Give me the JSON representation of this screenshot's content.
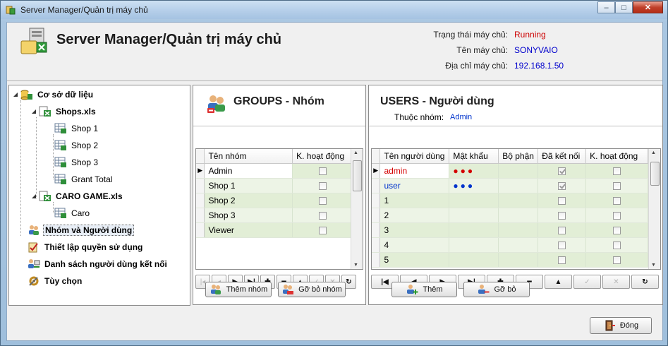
{
  "window": {
    "title": "Server Manager/Quản trị máy chủ",
    "minimize": "–",
    "maximize": "□",
    "close": "✕"
  },
  "header": {
    "title": "Server Manager/Quản trị máy chủ",
    "status_label": "Trạng thái máy chủ:",
    "status_value": "Running",
    "name_label": "Tên máy chủ:",
    "name_value": "SONYVAIO",
    "ip_label": "Địa chỉ máy chủ:",
    "ip_value": "192.168.1.50"
  },
  "tree": {
    "db": "Cơ sở dữ liệu",
    "shops_file": "Shops.xls",
    "sheets": [
      "Shop 1",
      "Shop 2",
      "Shop 3",
      "Grant Total"
    ],
    "caro_file": "CARO GAME.xls",
    "caro_sheet": "Caro",
    "groups_users": "Nhóm và Người dùng",
    "permissions": "Thiết lập quyền sử dụng",
    "connected": "Danh sách người dùng kết nối",
    "options": "Tùy chọn"
  },
  "groups": {
    "title": "GROUPS - Nhóm",
    "columns": [
      "Tên nhóm",
      "K. hoạt động"
    ],
    "rows": [
      {
        "name": "Admin",
        "inactive": false
      },
      {
        "name": "Shop 1",
        "inactive": false
      },
      {
        "name": "Shop 2",
        "inactive": false
      },
      {
        "name": "Shop 3",
        "inactive": false
      },
      {
        "name": "Viewer",
        "inactive": false
      }
    ],
    "add_button": "Thêm nhóm",
    "remove_button": "Gỡ bỏ nhóm"
  },
  "users": {
    "title": "USERS - Người dùng",
    "group_label": "Thuộc nhóm:",
    "group_value": "Admin",
    "columns": [
      "Tên người dùng",
      "Mật khẩu",
      "Bộ phận",
      "Đã kết nối",
      "K. hoạt động"
    ],
    "rows": [
      {
        "name": "admin",
        "password": "●●●",
        "dept": "",
        "connected": true,
        "inactive": false
      },
      {
        "name": "user",
        "password": "●●●",
        "dept": "",
        "connected": true,
        "inactive": false
      },
      {
        "name": "1",
        "password": "",
        "dept": "",
        "connected": false,
        "inactive": false
      },
      {
        "name": "2",
        "password": "",
        "dept": "",
        "connected": false,
        "inactive": false
      },
      {
        "name": "3",
        "password": "",
        "dept": "",
        "connected": false,
        "inactive": false
      },
      {
        "name": "4",
        "password": "",
        "dept": "",
        "connected": false,
        "inactive": false
      },
      {
        "name": "5",
        "password": "",
        "dept": "",
        "connected": false,
        "inactive": false
      }
    ],
    "add_button": "Thêm",
    "remove_button": "Gỡ bỏ"
  },
  "close_button": "Đóng",
  "colors": {
    "accent_red": "#cc0000",
    "link_blue": "#0000cc",
    "row_green": "#e2eed6"
  },
  "icons": [
    "app-icon",
    "server-icon",
    "database-icon",
    "excel-file-icon",
    "sheet-icon",
    "users-group-icon",
    "permission-icon",
    "connected-users-icon",
    "options-icon",
    "exit-door-icon"
  ]
}
